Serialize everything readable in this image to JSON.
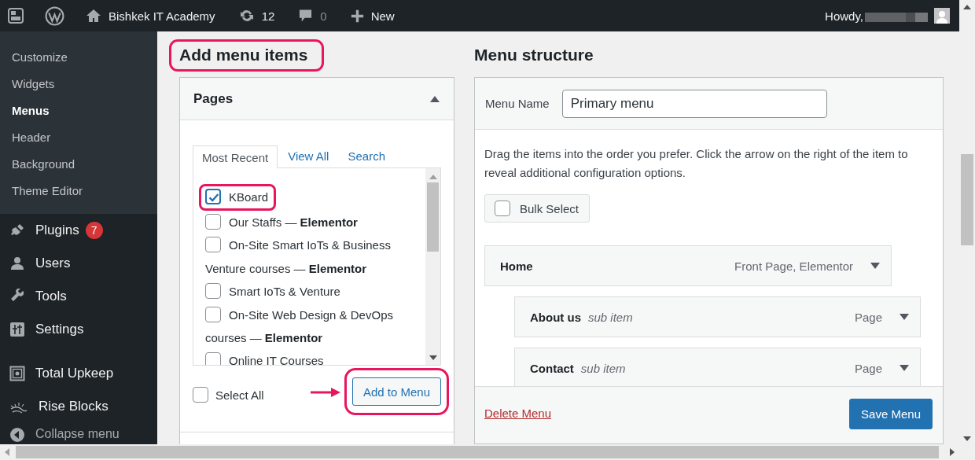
{
  "admin_bar": {
    "site_name": "Bishkek IT Academy",
    "updates": "12",
    "comments": "0",
    "new_label": "New",
    "greeting": "Howdy,"
  },
  "sidebar": {
    "submenu": [
      {
        "label": "Customize",
        "selected": false
      },
      {
        "label": "Widgets",
        "selected": false
      },
      {
        "label": "Menus",
        "selected": true
      },
      {
        "label": "Header",
        "selected": false
      },
      {
        "label": "Background",
        "selected": false
      },
      {
        "label": "Theme Editor",
        "selected": false
      }
    ],
    "items": [
      {
        "label": "Plugins",
        "badge": "7"
      },
      {
        "label": "Users"
      },
      {
        "label": "Tools"
      },
      {
        "label": "Settings"
      },
      {
        "label": "Total Upkeep"
      },
      {
        "label": "Rise Blocks"
      }
    ],
    "collapse_label": "Collapse menu"
  },
  "add_menu_items": {
    "title": "Add menu items",
    "highlighted": true,
    "panel": {
      "title": "Pages",
      "expanded": true,
      "tabs": [
        {
          "label": "Most Recent",
          "selected": true
        },
        {
          "label": "View All",
          "selected": false
        },
        {
          "label": "Search",
          "selected": false
        }
      ],
      "items": [
        {
          "label": "KBoard",
          "checked": true,
          "highlighted": true
        },
        {
          "label": "Our Staffs — **Elementor**",
          "checked": false,
          "highlighted": false
        },
        {
          "label": "On-Site Smart IoTs & Business Venture courses — **Elementor**",
          "checked": false,
          "highlighted": false
        },
        {
          "label": "Smart IoTs & Venture",
          "checked": false,
          "highlighted": false
        },
        {
          "label": "On-Site Web Design & DevOps courses — **Elementor**",
          "checked": false,
          "highlighted": false
        },
        {
          "label": "Online IT Courses",
          "checked": false,
          "highlighted": false
        }
      ],
      "select_all": {
        "label": "Select All",
        "checked": false
      },
      "add_button": {
        "label": "Add to Menu",
        "highlighted": true,
        "arrow": true
      }
    }
  },
  "menu_structure": {
    "title": "Menu structure",
    "name_label": "Menu Name",
    "name_value": "Primary menu",
    "instructions": "Drag the items into the order you prefer. Click the arrow on the right of the item to reveal additional configuration options.",
    "bulk_select": {
      "label": "Bulk Select",
      "checked": false
    },
    "items": [
      {
        "title": "Home",
        "type": "Front Page, Elementor",
        "children": [
          {
            "title": "About us",
            "note": "sub item",
            "type": "Page"
          },
          {
            "title": "Contact",
            "note": "sub item",
            "type": "Page"
          }
        ]
      }
    ],
    "delete_label": "Delete Menu",
    "save_label": "Save Menu"
  }
}
